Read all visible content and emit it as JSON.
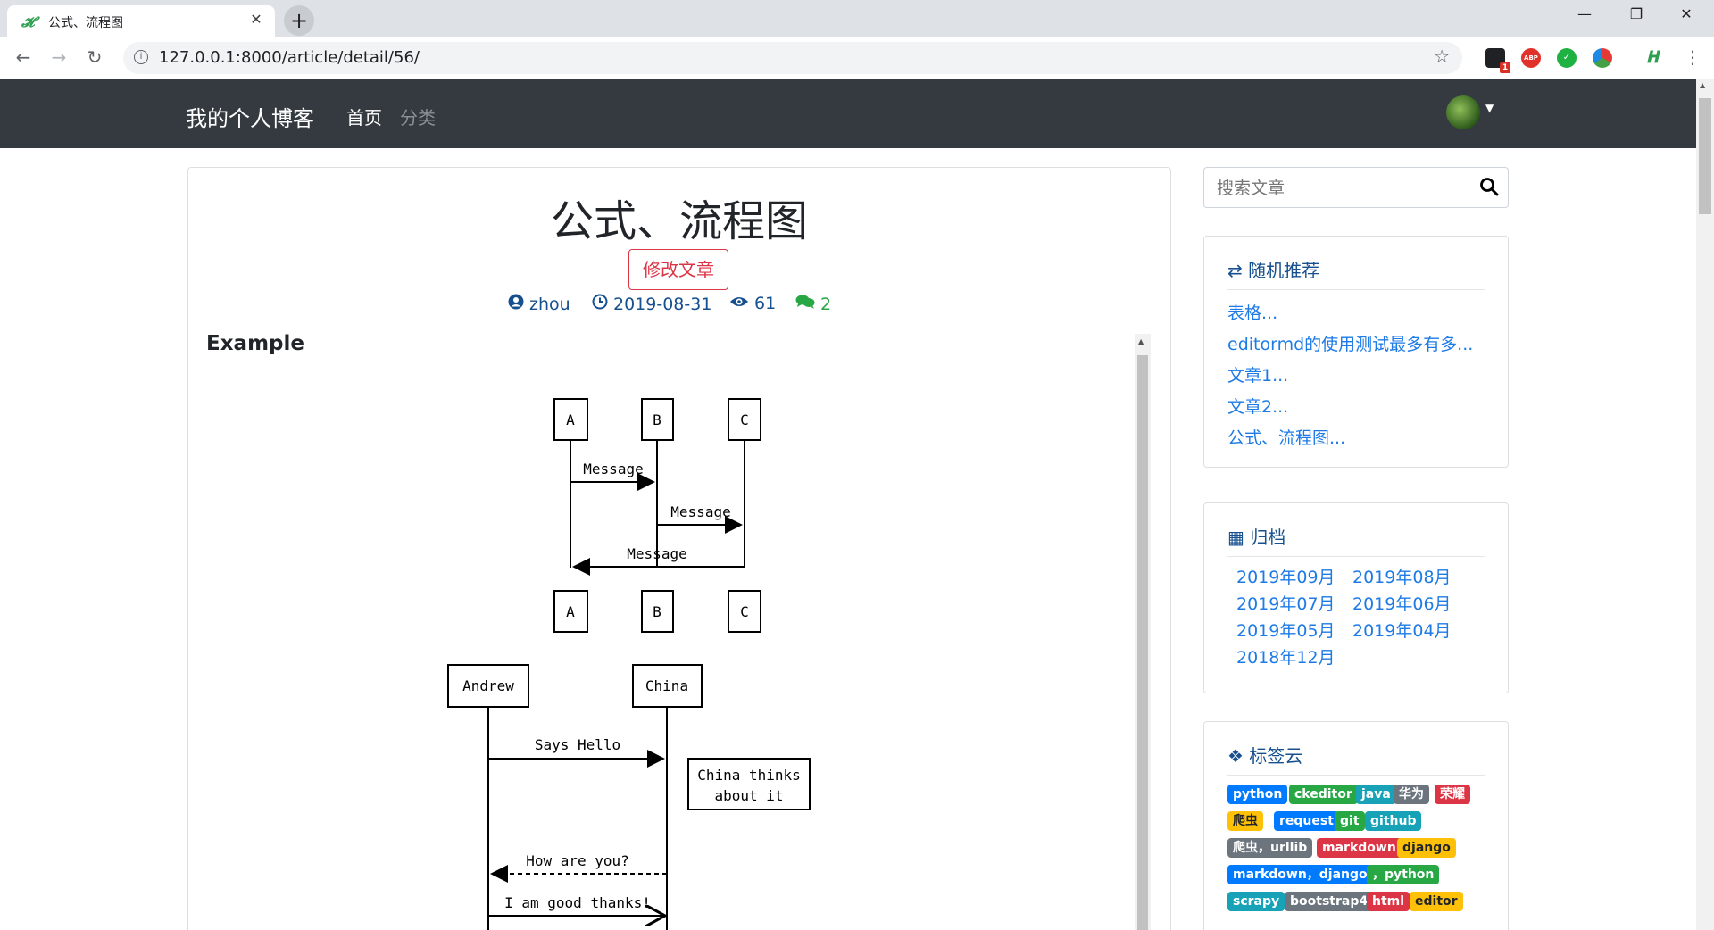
{
  "browser": {
    "tab_title": "公式、流程图",
    "tab_favicon": "𝓗",
    "tab_close": "✕",
    "new_tab": "+",
    "url": "127.0.0.1:8000/article/detail/56/",
    "ext_badge": "1",
    "ext_abp": "ABP"
  },
  "navbar": {
    "brand": "我的个人博客",
    "home": "首页",
    "category": "分类"
  },
  "article": {
    "title": "公式、流程图",
    "edit_button": "修改文章",
    "author": "zhou",
    "date": "2019-08-31",
    "views": "61",
    "comments": "2",
    "heading": "Example"
  },
  "diagram1": {
    "actors": [
      "A",
      "B",
      "C"
    ],
    "messages": [
      "Message",
      "Message",
      "Message"
    ]
  },
  "diagram2": {
    "actors": [
      "Andrew",
      "China"
    ],
    "note_line1": "China thinks",
    "note_line2": "about it",
    "msg1": "Says Hello",
    "msg2": "How are you?",
    "msg3": "I am good thanks!"
  },
  "sidebar": {
    "search_placeholder": "搜索文章",
    "random_title": "随机推荐",
    "random_items": [
      "表格...",
      "editormd的使用测试最多有多...",
      "文章1...",
      "文章2...",
      "公式、流程图..."
    ],
    "archive_title": "归档",
    "archive_items": [
      "2019年09月",
      "2019年08月",
      "2019年07月",
      "2019年06月",
      "2019年05月",
      "2019年04月",
      "2018年12月"
    ],
    "tags_title": "标签云",
    "tags": [
      {
        "label": "python",
        "color": "#007bff"
      },
      {
        "label": "ckeditor",
        "color": "#28a745"
      },
      {
        "label": "java",
        "color": "#17a2b8"
      },
      {
        "label": "华为",
        "color": "#6c757d"
      },
      {
        "label": "荣耀",
        "color": "#dc3545"
      },
      {
        "label": "爬虫",
        "color": "#ffc107"
      },
      {
        "label": "request",
        "color": "#007bff"
      },
      {
        "label": "git",
        "color": "#28a745"
      },
      {
        "label": "github",
        "color": "#17a2b8"
      },
      {
        "label": "爬虫，urllib",
        "color": "#6c757d"
      },
      {
        "label": "markdown",
        "color": "#dc3545"
      },
      {
        "label": "django",
        "color": "#ffc107"
      },
      {
        "label": "markdown，django",
        "color": "#007bff"
      },
      {
        "label": "，python",
        "color": "#28a745"
      },
      {
        "label": "scrapy",
        "color": "#17a2b8"
      },
      {
        "label": "bootstrap4",
        "color": "#6c757d"
      },
      {
        "label": "html",
        "color": "#dc3545"
      },
      {
        "label": "editor",
        "color": "#ffc107"
      }
    ]
  }
}
